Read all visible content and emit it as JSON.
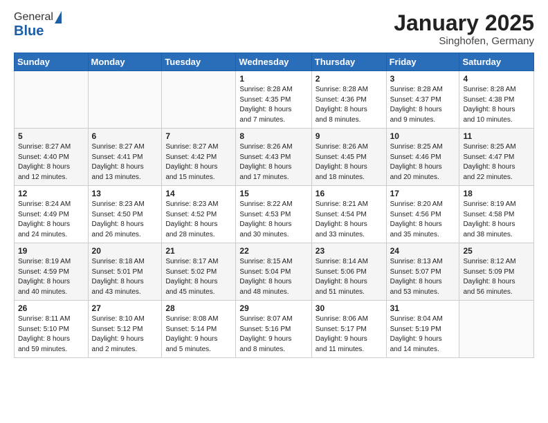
{
  "header": {
    "logo": {
      "general": "General",
      "blue": "Blue"
    },
    "title": "January 2025",
    "location": "Singhofen, Germany"
  },
  "weekdays": [
    "Sunday",
    "Monday",
    "Tuesday",
    "Wednesday",
    "Thursday",
    "Friday",
    "Saturday"
  ],
  "weeks": [
    [
      {
        "day": "",
        "info": ""
      },
      {
        "day": "",
        "info": ""
      },
      {
        "day": "",
        "info": ""
      },
      {
        "day": "1",
        "info": "Sunrise: 8:28 AM\nSunset: 4:35 PM\nDaylight: 8 hours\nand 7 minutes."
      },
      {
        "day": "2",
        "info": "Sunrise: 8:28 AM\nSunset: 4:36 PM\nDaylight: 8 hours\nand 8 minutes."
      },
      {
        "day": "3",
        "info": "Sunrise: 8:28 AM\nSunset: 4:37 PM\nDaylight: 8 hours\nand 9 minutes."
      },
      {
        "day": "4",
        "info": "Sunrise: 8:28 AM\nSunset: 4:38 PM\nDaylight: 8 hours\nand 10 minutes."
      }
    ],
    [
      {
        "day": "5",
        "info": "Sunrise: 8:27 AM\nSunset: 4:40 PM\nDaylight: 8 hours\nand 12 minutes."
      },
      {
        "day": "6",
        "info": "Sunrise: 8:27 AM\nSunset: 4:41 PM\nDaylight: 8 hours\nand 13 minutes."
      },
      {
        "day": "7",
        "info": "Sunrise: 8:27 AM\nSunset: 4:42 PM\nDaylight: 8 hours\nand 15 minutes."
      },
      {
        "day": "8",
        "info": "Sunrise: 8:26 AM\nSunset: 4:43 PM\nDaylight: 8 hours\nand 17 minutes."
      },
      {
        "day": "9",
        "info": "Sunrise: 8:26 AM\nSunset: 4:45 PM\nDaylight: 8 hours\nand 18 minutes."
      },
      {
        "day": "10",
        "info": "Sunrise: 8:25 AM\nSunset: 4:46 PM\nDaylight: 8 hours\nand 20 minutes."
      },
      {
        "day": "11",
        "info": "Sunrise: 8:25 AM\nSunset: 4:47 PM\nDaylight: 8 hours\nand 22 minutes."
      }
    ],
    [
      {
        "day": "12",
        "info": "Sunrise: 8:24 AM\nSunset: 4:49 PM\nDaylight: 8 hours\nand 24 minutes."
      },
      {
        "day": "13",
        "info": "Sunrise: 8:23 AM\nSunset: 4:50 PM\nDaylight: 8 hours\nand 26 minutes."
      },
      {
        "day": "14",
        "info": "Sunrise: 8:23 AM\nSunset: 4:52 PM\nDaylight: 8 hours\nand 28 minutes."
      },
      {
        "day": "15",
        "info": "Sunrise: 8:22 AM\nSunset: 4:53 PM\nDaylight: 8 hours\nand 30 minutes."
      },
      {
        "day": "16",
        "info": "Sunrise: 8:21 AM\nSunset: 4:54 PM\nDaylight: 8 hours\nand 33 minutes."
      },
      {
        "day": "17",
        "info": "Sunrise: 8:20 AM\nSunset: 4:56 PM\nDaylight: 8 hours\nand 35 minutes."
      },
      {
        "day": "18",
        "info": "Sunrise: 8:19 AM\nSunset: 4:58 PM\nDaylight: 8 hours\nand 38 minutes."
      }
    ],
    [
      {
        "day": "19",
        "info": "Sunrise: 8:19 AM\nSunset: 4:59 PM\nDaylight: 8 hours\nand 40 minutes."
      },
      {
        "day": "20",
        "info": "Sunrise: 8:18 AM\nSunset: 5:01 PM\nDaylight: 8 hours\nand 43 minutes."
      },
      {
        "day": "21",
        "info": "Sunrise: 8:17 AM\nSunset: 5:02 PM\nDaylight: 8 hours\nand 45 minutes."
      },
      {
        "day": "22",
        "info": "Sunrise: 8:15 AM\nSunset: 5:04 PM\nDaylight: 8 hours\nand 48 minutes."
      },
      {
        "day": "23",
        "info": "Sunrise: 8:14 AM\nSunset: 5:06 PM\nDaylight: 8 hours\nand 51 minutes."
      },
      {
        "day": "24",
        "info": "Sunrise: 8:13 AM\nSunset: 5:07 PM\nDaylight: 8 hours\nand 53 minutes."
      },
      {
        "day": "25",
        "info": "Sunrise: 8:12 AM\nSunset: 5:09 PM\nDaylight: 8 hours\nand 56 minutes."
      }
    ],
    [
      {
        "day": "26",
        "info": "Sunrise: 8:11 AM\nSunset: 5:10 PM\nDaylight: 8 hours\nand 59 minutes."
      },
      {
        "day": "27",
        "info": "Sunrise: 8:10 AM\nSunset: 5:12 PM\nDaylight: 9 hours\nand 2 minutes."
      },
      {
        "day": "28",
        "info": "Sunrise: 8:08 AM\nSunset: 5:14 PM\nDaylight: 9 hours\nand 5 minutes."
      },
      {
        "day": "29",
        "info": "Sunrise: 8:07 AM\nSunset: 5:16 PM\nDaylight: 9 hours\nand 8 minutes."
      },
      {
        "day": "30",
        "info": "Sunrise: 8:06 AM\nSunset: 5:17 PM\nDaylight: 9 hours\nand 11 minutes."
      },
      {
        "day": "31",
        "info": "Sunrise: 8:04 AM\nSunset: 5:19 PM\nDaylight: 9 hours\nand 14 minutes."
      },
      {
        "day": "",
        "info": ""
      }
    ]
  ]
}
